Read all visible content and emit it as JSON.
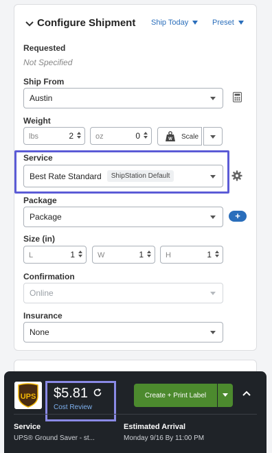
{
  "header": {
    "title": "Configure Shipment",
    "ship_today": "Ship Today",
    "preset": "Preset"
  },
  "requested": {
    "label": "Requested",
    "value": "Not Specified"
  },
  "ship_from": {
    "label": "Ship From",
    "value": "Austin"
  },
  "weight": {
    "label": "Weight",
    "lbs_unit": "lbs",
    "lbs_value": "2",
    "oz_unit": "oz",
    "oz_value": "0",
    "scale_label": "Scale"
  },
  "service": {
    "label": "Service",
    "value": "Best Rate Standard",
    "badge": "ShipStation Default"
  },
  "package": {
    "label": "Package",
    "value": "Package",
    "add_label": "+"
  },
  "size": {
    "label": "Size (in)",
    "l_unit": "L",
    "l_value": "1",
    "w_unit": "W",
    "w_value": "1",
    "h_unit": "H",
    "h_value": "1"
  },
  "confirmation": {
    "label": "Confirmation",
    "value": "Online"
  },
  "insurance": {
    "label": "Insurance",
    "value": "None"
  },
  "footer": {
    "carrier_logo_text": "UPS",
    "price": "$5.81",
    "cost_review": "Cost Review",
    "create_label": "Create + Print Label",
    "service_label": "Service",
    "service_value": "UPS® Ground Saver - st...",
    "arrival_label": "Estimated Arrival",
    "arrival_value": "Monday 9/16 By 11:00 PM"
  },
  "colors": {
    "accent": "#2a6ebb",
    "highlight": "#5b5bd6",
    "create_button": "#4c8a2e",
    "footer_bg": "#1f2328"
  }
}
